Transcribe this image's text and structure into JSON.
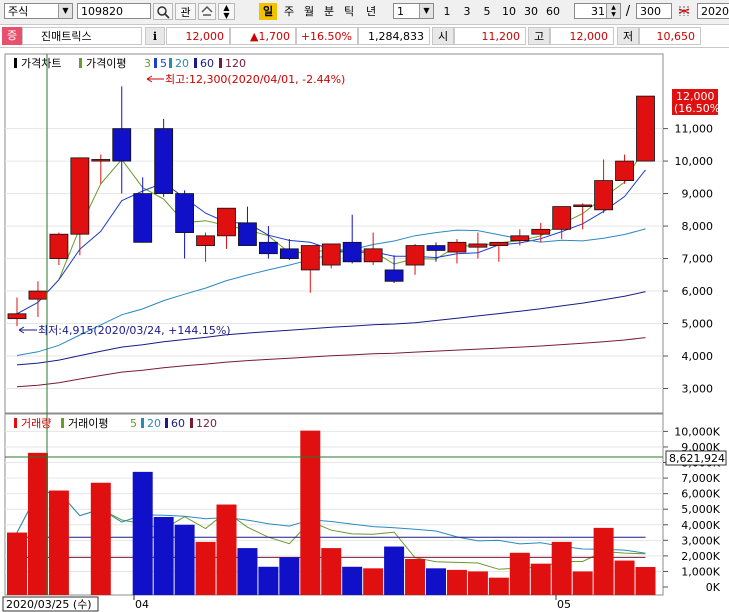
{
  "toolbar": {
    "market": "주식",
    "code": "109820",
    "search_icon": "magnifier-icon",
    "btn_gwan": "관",
    "period_selected": "일",
    "periods": [
      "주",
      "월",
      "분",
      "틱",
      "년"
    ],
    "interval_value": "1",
    "quick_intervals": [
      "1",
      "3",
      "5",
      "10",
      "30",
      "60"
    ],
    "display_count": "31",
    "total_count": "300",
    "date_value": "2020/"
  },
  "quote": {
    "tag": "증",
    "name": "진매트릭스",
    "info_button": "i",
    "price": "12,000",
    "change": "▲1,700",
    "change_rate": "+16.50%",
    "volume": "1,284,833",
    "open_label": "시",
    "open": "11,200",
    "high_label": "고",
    "high": "12,000",
    "low_label": "저",
    "low": "10,650"
  },
  "price_panel": {
    "legend": {
      "title": "가격차트",
      "ma_label": "가격이평",
      "periods": [
        "3",
        "5",
        "20",
        "60",
        "120"
      ]
    },
    "max_annotation": "최고:12,300(2020/04/01, -2.44%)",
    "min_annotation": "최저:4,915(2020/03/24, +144.15%)",
    "current_price_tag": "12,000",
    "current_rate_tag": "(16.50%)",
    "y_ticks": [
      "11,000",
      "10,000",
      "9,000",
      "8,000",
      "7,000",
      "6,000",
      "5,000",
      "4,000",
      "3,000"
    ]
  },
  "volume_panel": {
    "legend": {
      "title": "거래량",
      "ma_label": "거래이평",
      "periods": [
        "5",
        "20",
        "60",
        "120"
      ]
    },
    "current_volume_tag": "8,621,924",
    "y_ticks": [
      "10,000K",
      "9,000K",
      "8,000K",
      "7,000K",
      "6,000K",
      "5,000K",
      "4,000K",
      "3,000K",
      "2,000K",
      "1,000K",
      "0K"
    ]
  },
  "x_axis": {
    "cursor_date": "2020/03/25 (수)",
    "labels": [
      "04",
      "05"
    ]
  },
  "colors": {
    "up": "#e01010",
    "down": "#1010c8",
    "ma3": "#6a9a2a",
    "ma5": "#1f3fc8",
    "ma20": "#2a8ac0",
    "ma60": "#1a1a8a",
    "ma120": "#7a1a3a",
    "cursor": "#2a7a2a",
    "accent_yellow": "#f2c200"
  },
  "chart_data": {
    "type": "candlestick",
    "dates": [
      "03/23",
      "03/24",
      "03/25",
      "03/26",
      "03/27",
      "03/30",
      "03/31",
      "04/01",
      "04/02",
      "04/03",
      "04/06",
      "04/07",
      "04/08",
      "04/09",
      "04/10",
      "04/13",
      "04/14",
      "04/16",
      "04/17",
      "04/20",
      "04/21",
      "04/22",
      "04/23",
      "04/24",
      "04/27",
      "04/28",
      "04/29",
      "05/04",
      "05/06",
      "05/07",
      "05/08"
    ],
    "open": [
      5150,
      5750,
      7000,
      7750,
      10000,
      11000,
      9000,
      11000,
      9000,
      7400,
      7700,
      8100,
      7500,
      7300,
      6650,
      6800,
      7500,
      6900,
      6650,
      6800,
      7400,
      7200,
      7350,
      7400,
      7550,
      7750,
      7900,
      8600,
      8500,
      9400,
      10000
    ],
    "high": [
      5800,
      6300,
      7800,
      7850,
      10200,
      12300,
      9500,
      11300,
      9100,
      7800,
      8400,
      8600,
      8000,
      7600,
      7300,
      7400,
      8350,
      7800,
      7100,
      7450,
      7500,
      7600,
      7800,
      7500,
      7900,
      8100,
      8600,
      8700,
      10050,
      10200,
      12000
    ],
    "low": [
      4915,
      5200,
      6800,
      7100,
      9300,
      9000,
      8300,
      8900,
      7000,
      6900,
      7300,
      7400,
      7000,
      6950,
      5950,
      6700,
      6850,
      6800,
      6250,
      6500,
      6900,
      6850,
      7000,
      6900,
      7400,
      7500,
      7600,
      7900,
      8400,
      9300,
      10650
    ],
    "close": [
      5300,
      6000,
      7750,
      10100,
      10050,
      10000,
      7500,
      9000,
      7800,
      7700,
      8550,
      7400,
      7150,
      7000,
      7400,
      7450,
      6900,
      7300,
      6300,
      7400,
      7250,
      7500,
      7450,
      7500,
      7700,
      7900,
      8600,
      8650,
      9400,
      10000,
      12000
    ],
    "volume_k": [
      3500,
      8621,
      6200,
      0,
      6700,
      0,
      7400,
      4500,
      4000,
      2900,
      5300,
      2500,
      1300,
      1900,
      10050,
      2500,
      1300,
      1200,
      2600,
      1800,
      1200,
      1100,
      1000,
      600,
      2200,
      1500,
      2900,
      1000,
      3800,
      1700,
      1284
    ]
  }
}
